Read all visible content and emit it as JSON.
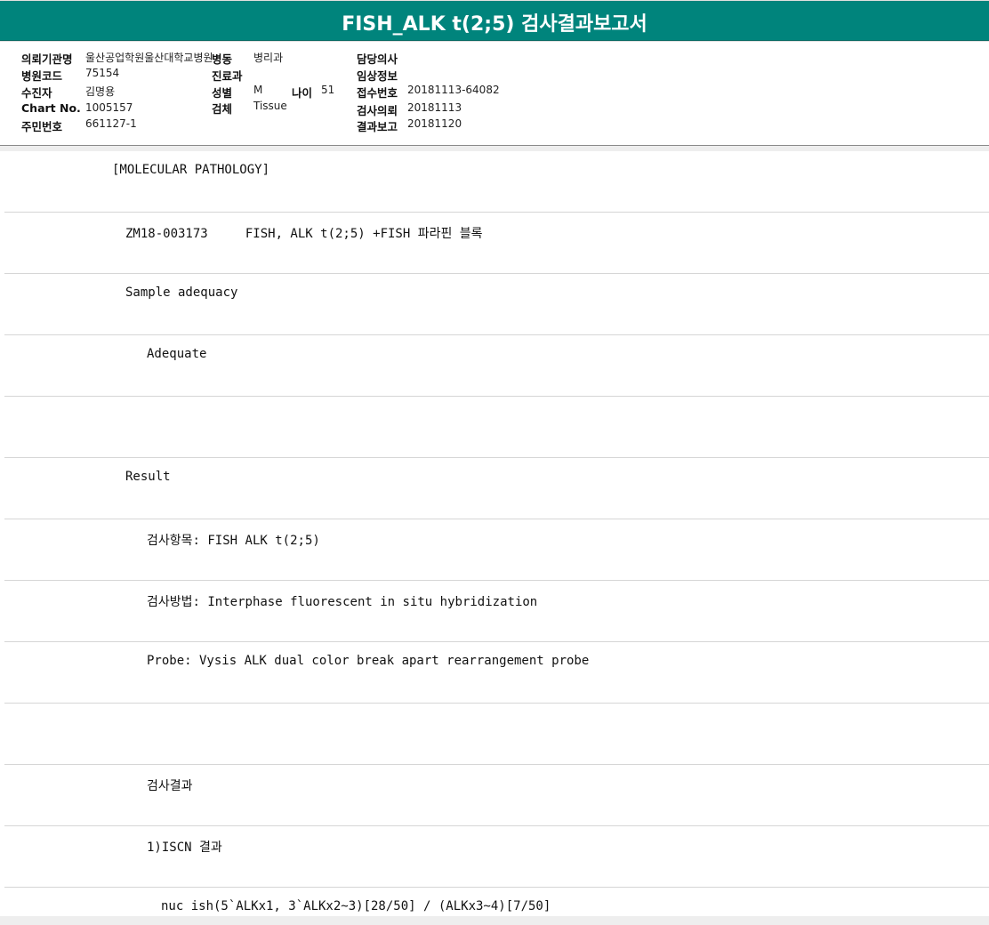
{
  "title": "FISH_ALK t(2;5) 검사결과보고서",
  "header": {
    "institution_label": "의뢰기관명",
    "institution_value": "울산공업학원울산대학교병원",
    "ward_label": "병동",
    "ward_value": "병리과",
    "doctor_label": "담당의사",
    "doctor_value": "",
    "hospital_code_label": "병원코드",
    "hospital_code_value": "75154",
    "department_label": "진료과",
    "department_value": "",
    "clinical_info_label": "임상정보",
    "clinical_info_value": "",
    "patient_label": "수진자",
    "patient_value": "김명용",
    "sex_label": "성별",
    "sex_value": "M",
    "age_label": "나이",
    "age_value": "51",
    "receipt_no_label": "접수번호",
    "receipt_no_value": "20181113-64082",
    "chart_no_label": "Chart No.",
    "chart_no_value": "1005157",
    "specimen_label": "검체",
    "specimen_value": "Tissue",
    "request_date_label": "검사의뢰",
    "request_date_value": "20181113",
    "id_no_label": "주민번호",
    "id_no_value": "661127-1",
    "report_date_label": "결과보고",
    "report_date_value": "20181120"
  },
  "report_lines": [
    "[MOLECULAR PATHOLOGY]",
    "ZM18-003173     FISH, ALK t(2;5) +FISH 파라핀 블록",
    "Sample adequacy",
    "Adequate",
    "",
    "Result",
    "검사항목: FISH ALK t(2;5)",
    "검사방법: Interphase fluorescent in situ hybridization",
    "Probe: Vysis ALK dual color break apart rearrangement probe",
    "",
    "검사결과",
    "1)ISCN 결과",
    "nuc ish(5`ALKx1, 3`ALKx2~3)[28/50] / (ALKx3~4)[7/50]"
  ]
}
